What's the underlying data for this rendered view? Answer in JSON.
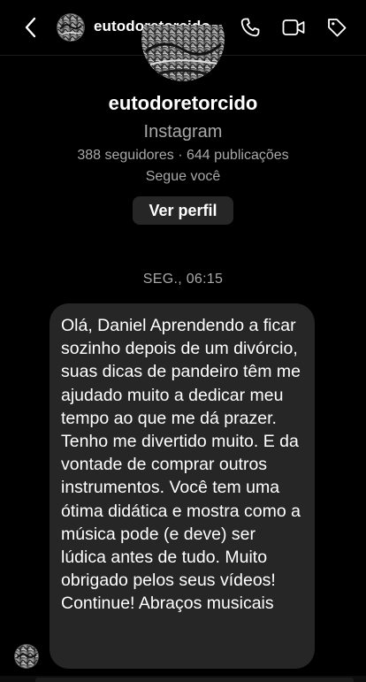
{
  "header": {
    "username": "eutodoretorcido",
    "icons": [
      "chevron-left-icon",
      "phone-icon",
      "video-camera-icon",
      "tag-icon"
    ]
  },
  "profile": {
    "name": "eutodoretorcido",
    "platform": "Instagram",
    "stats": "388 seguidores · 644 publicações",
    "follow_status": "Segue você",
    "view_profile_label": "Ver perfil"
  },
  "conversation": {
    "timestamp": "SEG., 06:15",
    "message": "Olá, Daniel Aprendendo a ficar sozinho depois de um divórcio, suas dicas de pandeiro têm me ajudado muito a dedicar meu tempo ao que me dá prazer. Tenho me divertido muito. E da vontade de comprar outros instrumentos. Você tem uma ótima didática e mostra como a música pode (e deve) ser lúdica antes de tudo. Muito obrigado pelos seus vídeos! Continue! Abraços musicais"
  },
  "colors": {
    "background": "#000000",
    "bubble": "#262626",
    "secondary_text": "#a8a8a8",
    "button": "#262626"
  }
}
